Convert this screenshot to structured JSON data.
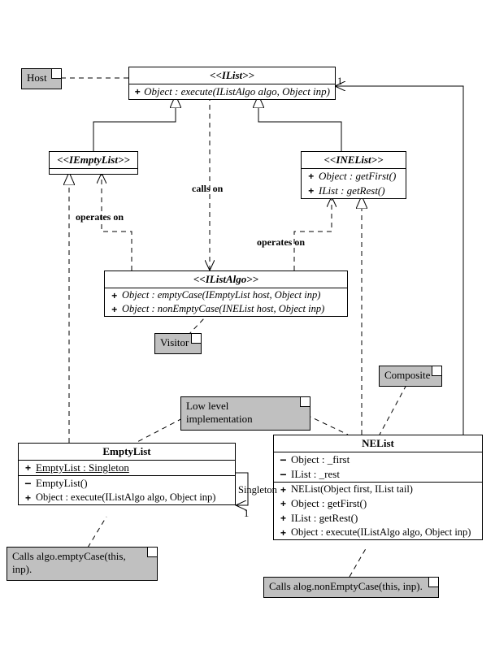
{
  "notes": {
    "host": "Host",
    "visitor": "Visitor",
    "composite": "Composite",
    "low_level": "Low level implementation",
    "empty_exec": "Calls algo.emptyCase(this, inp).",
    "nelist_exec": "Calls alog.nonEmptyCase(this, inp)."
  },
  "labels": {
    "calls_on": "calls on",
    "operates_on_left": "operates on",
    "operates_on_right": "operates on",
    "singleton": "Singleton",
    "one_top": "1",
    "one_bottom": "1"
  },
  "ilist": {
    "title": "<<IList>>",
    "op_vis": "+",
    "op": "Object : execute(IListAlgo algo, Object inp)"
  },
  "iemptylist": {
    "title": "<<IEmptyList>>"
  },
  "inelist": {
    "title": "<<INEList>>",
    "m1_vis": "+",
    "m1": "Object : getFirst()",
    "m2_vis": "+",
    "m2": "IList : getRest()"
  },
  "ilistalgo": {
    "title": "<<IListAlgo>>",
    "m1_vis": "+",
    "m1": "Object : emptyCase(IEmptyList host, Object inp)",
    "m2_vis": "+",
    "m2": "Object : nonEmptyCase(INEList host, Object inp)"
  },
  "emptylist": {
    "title": "EmptyList",
    "a1_vis": "+",
    "a1": "EmptyList : Singleton",
    "m1_vis": "−",
    "m1": "EmptyList()",
    "m2_vis": "+",
    "m2": "Object : execute(IListAlgo algo, Object inp)"
  },
  "nelist": {
    "title": "NEList",
    "a1_vis": "−",
    "a1": "Object : _first",
    "a2_vis": "−",
    "a2": "IList : _rest",
    "m1_vis": "+",
    "m1": "NEList(Object first, IList tail)",
    "m2_vis": "+",
    "m2": "Object : getFirst()",
    "m3_vis": "+",
    "m3": "IList : getRest()",
    "m4_vis": "+",
    "m4": "Object : execute(IListAlgo algo, Object inp)"
  }
}
